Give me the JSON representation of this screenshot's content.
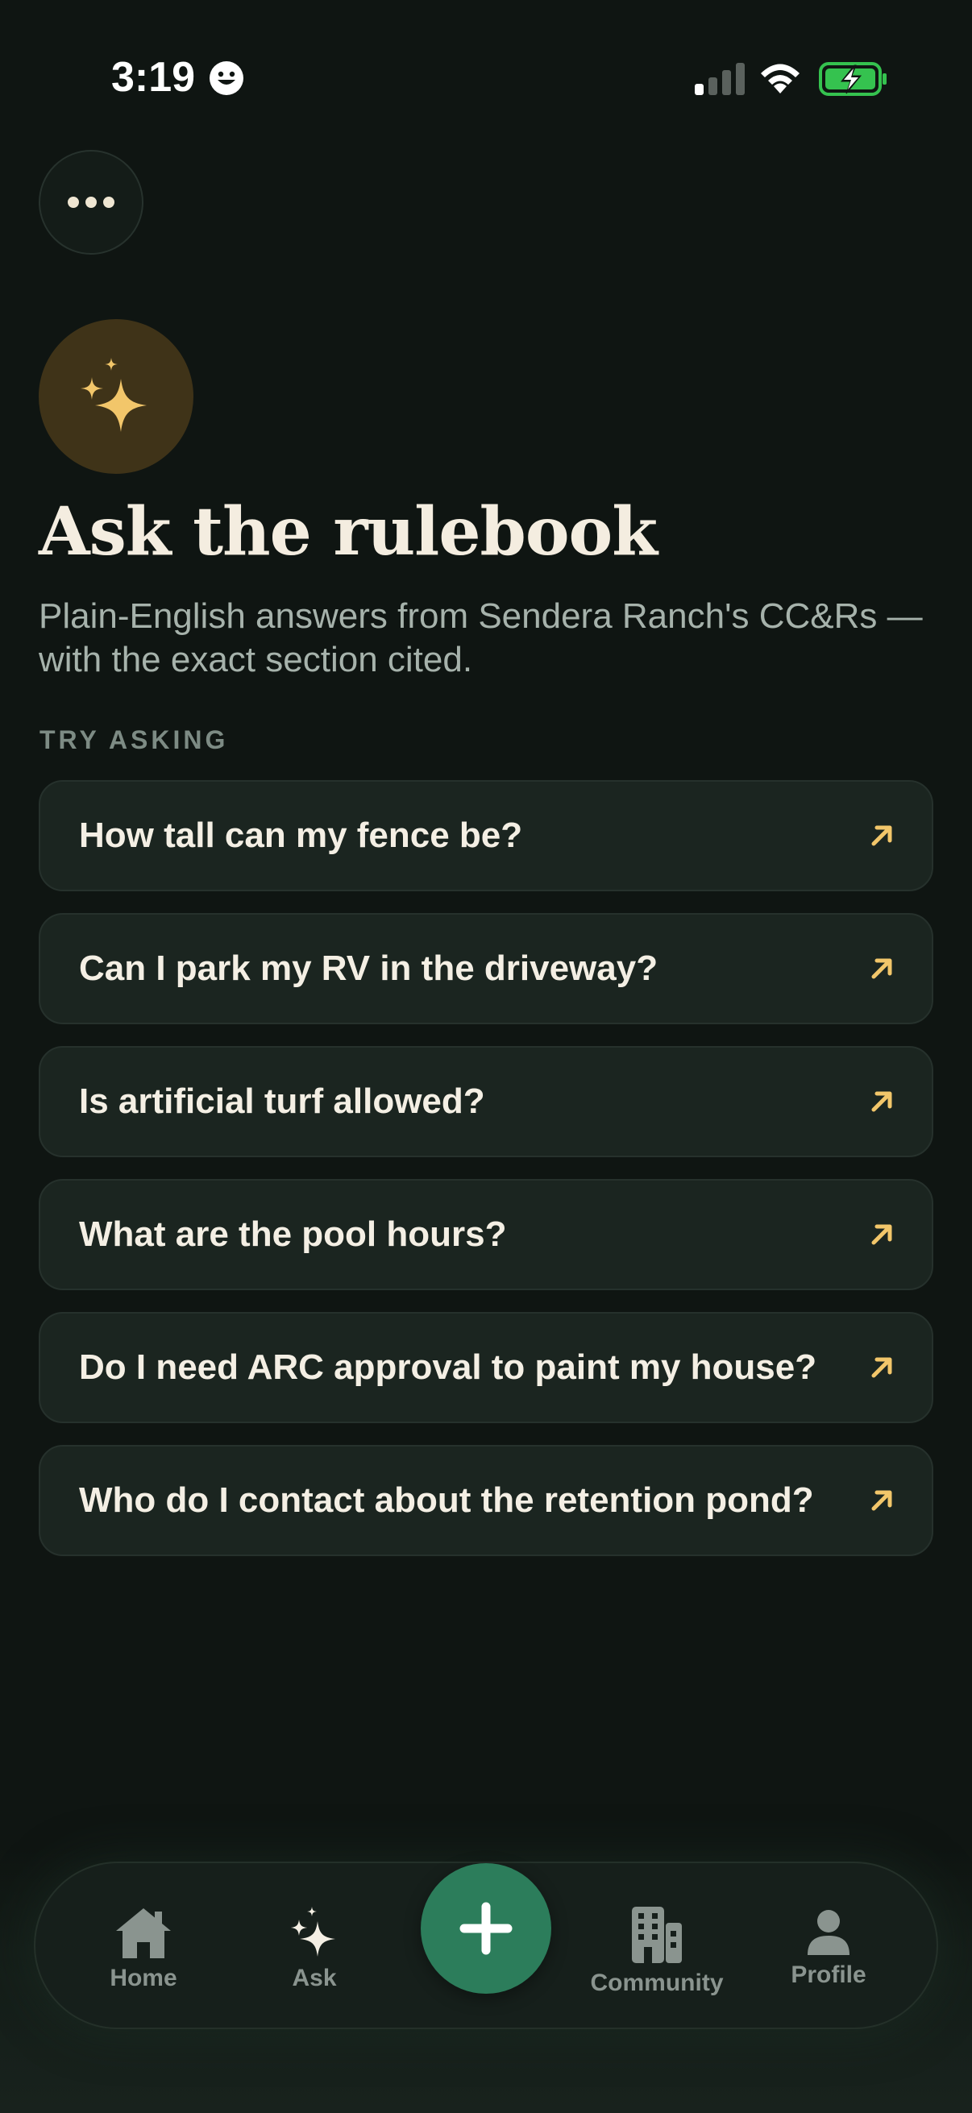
{
  "status_bar": {
    "time": "3:19",
    "icons": [
      "emoji-icon",
      "cellular-signal-icon",
      "wifi-icon",
      "battery-charging-icon"
    ],
    "battery_color": "#35c24f"
  },
  "header": {
    "more_icon": "more-dots-icon"
  },
  "hero": {
    "icon": "sparkles-icon",
    "title": "Ask the rulebook",
    "subtitle": "Plain-English answers from Sendera Ranch's CC&Rs — with the exact section cited."
  },
  "suggestions": {
    "section_label": "TRY ASKING",
    "items": [
      {
        "label": "How tall can my fence be?"
      },
      {
        "label": "Can I park my RV in the driveway?"
      },
      {
        "label": "Is artificial turf allowed?"
      },
      {
        "label": "What are the pool hours?"
      },
      {
        "label": "Do I need ARC approval to paint my house?"
      },
      {
        "label": "Who do I contact about the retention pond?"
      }
    ]
  },
  "tabbar": {
    "tabs": [
      {
        "label": "Home",
        "icon": "home-icon"
      },
      {
        "label": "Ask",
        "icon": "sparkles-icon",
        "active": true
      },
      {
        "label": "Community",
        "icon": "building-icon"
      },
      {
        "label": "Profile",
        "icon": "person-icon"
      }
    ],
    "fab_icon": "plus-icon"
  },
  "colors": {
    "background": "#0f1512",
    "accent_gold": "#f2c66a",
    "accent_green": "#2c7d5b",
    "card": "#1b2520"
  }
}
